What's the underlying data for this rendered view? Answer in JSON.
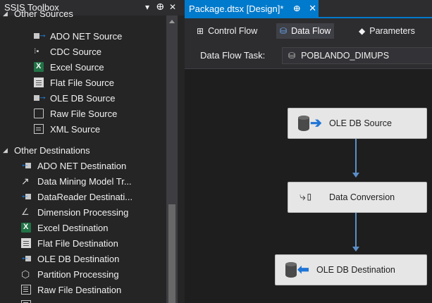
{
  "toolbox": {
    "title": "SSIS Toolbox",
    "header_icons": {
      "dropdown": "▾",
      "pin": "ⴲ",
      "close": "✕"
    },
    "groups": [
      {
        "label": "Other Sources",
        "expanded": true
      },
      {
        "label": "Other Destinations",
        "expanded": true
      }
    ],
    "sources": [
      {
        "label": "ADO NET Source",
        "icon": "ado-source-icon"
      },
      {
        "label": "CDC Source",
        "icon": "cdc-source-icon"
      },
      {
        "label": "Excel Source",
        "icon": "excel-icon"
      },
      {
        "label": "Flat File Source",
        "icon": "flat-file-icon"
      },
      {
        "label": "OLE DB Source",
        "icon": "ole-db-source-icon"
      },
      {
        "label": "Raw File Source",
        "icon": "raw-file-icon"
      },
      {
        "label": "XML Source",
        "icon": "xml-icon"
      }
    ],
    "destinations": [
      {
        "label": "ADO NET Destination",
        "icon": "ado-destination-icon"
      },
      {
        "label": "Data Mining Model Tr...",
        "icon": "data-mining-icon"
      },
      {
        "label": "DataReader Destinati...",
        "icon": "datareader-icon"
      },
      {
        "label": "Dimension Processing",
        "icon": "dimension-icon"
      },
      {
        "label": "Excel Destination",
        "icon": "excel-icon"
      },
      {
        "label": "Flat File Destination",
        "icon": "flat-file-icon"
      },
      {
        "label": "OLE DB Destination",
        "icon": "ole-db-destination-icon"
      },
      {
        "label": "Partition Processing",
        "icon": "partition-icon"
      },
      {
        "label": "Raw File Destination",
        "icon": "raw-file-destination-icon"
      }
    ]
  },
  "document": {
    "tab_title": "Package.dtsx [Design]*",
    "pin_glyph": "ⴲ",
    "close_glyph": "✕"
  },
  "view_tabs": [
    {
      "label": "Control Flow",
      "icon": "control-flow-icon",
      "active": false
    },
    {
      "label": "Data Flow",
      "icon": "data-flow-icon",
      "active": true
    },
    {
      "label": "Parameters",
      "icon": "parameters-icon",
      "active": false
    }
  ],
  "task_bar": {
    "label": "Data Flow Task:",
    "selected": "POBLANDO_DIMUPS"
  },
  "canvas": {
    "nodes": [
      {
        "label": "OLE DB Source"
      },
      {
        "label": "Data Conversion"
      },
      {
        "label": "OLE DB Destination"
      }
    ]
  },
  "colors": {
    "accent": "#007acc",
    "panel": "#252526",
    "canvas": "#1e1e1e",
    "path": "#5b8fc9"
  }
}
